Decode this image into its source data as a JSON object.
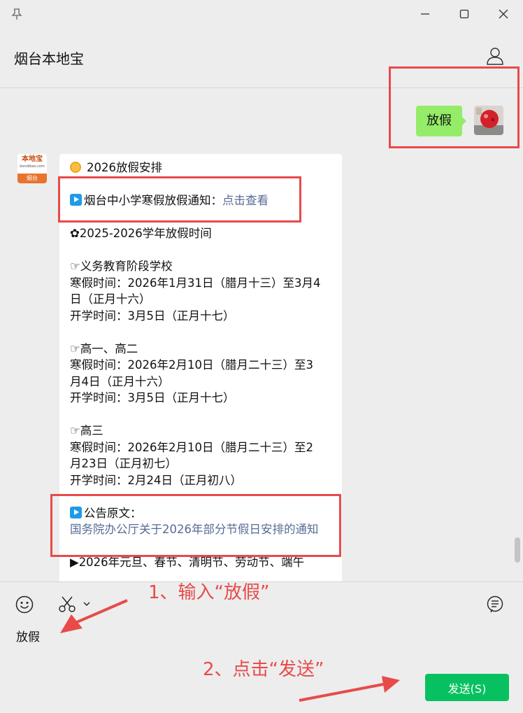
{
  "window": {
    "pin_icon": "pin-icon",
    "minimize_icon": "minimize-icon",
    "maximize_icon": "maximize-icon",
    "close_icon": "close-icon"
  },
  "header": {
    "title": "烟台本地宝",
    "profile_icon": "person-icon"
  },
  "messages": {
    "sent": {
      "text": "放假"
    },
    "bot_avatar": {
      "name": "本地宝",
      "site": "bendibao.com",
      "city": "烟台"
    },
    "reply": {
      "heading": "2026放假安排",
      "notice_label": "烟台中小学寒假放假通知：",
      "notice_link": "点击查看",
      "year_title": "✿2025-2026学年放假时间",
      "sections": [
        {
          "title": "☞义务教育阶段学校",
          "line1": "寒假时间：2026年1月31日（腊月十三）至3月4",
          "line2": "日（正月十六）",
          "line3": "开学时间：3月5日（正月十七）"
        },
        {
          "title": "☞高一、高二",
          "line1": "寒假时间：2026年2月10日（腊月二十三）至3",
          "line2": "月4日（正月十六）",
          "line3": "开学时间：3月5日（正月十七）"
        },
        {
          "title": "☞高三",
          "line1": "寒假时间：2026年2月10日（腊月二十三）至2",
          "line2": "月23日（正月初七）",
          "line3": "开学时间：2月24日（正月初八）"
        }
      ],
      "original_label": "公告原文：",
      "original_link": "国务院办公厅关于2026年部分节假日安排的通知",
      "cut_line": "▶2026年元旦、春节、清明节、劳动节、端午"
    }
  },
  "input": {
    "value": "放假",
    "send_label": "发送(S)",
    "emoji_icon": "emoji-icon",
    "screenshot_icon": "scissors-icon",
    "history_icon": "chat-history-icon"
  },
  "annotations": {
    "step1": "1、输入“放假”",
    "step2": "2、点击“发送”",
    "color": "#e84a4a"
  },
  "colors": {
    "sent_bubble": "#95ec69",
    "send_button": "#07c160",
    "link": "#576b95"
  }
}
